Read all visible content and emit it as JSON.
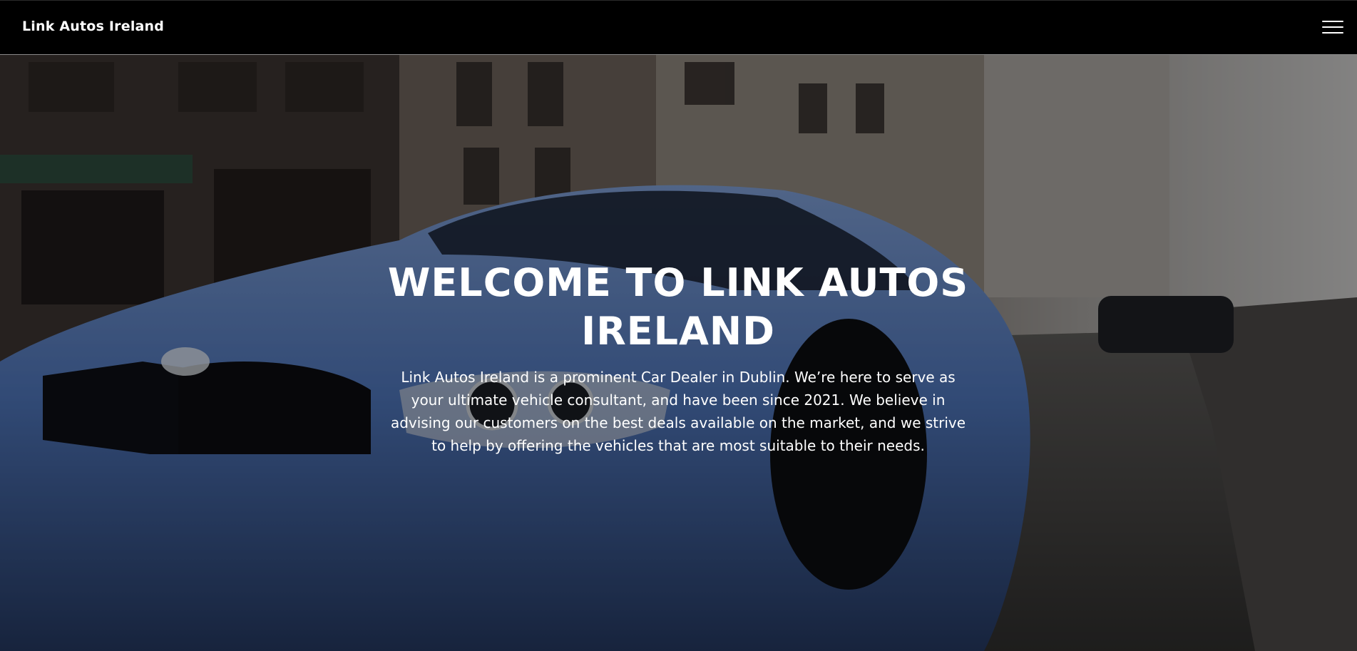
{
  "navbar": {
    "brand": "Link Autos Ireland",
    "menu_icon": "hamburger-menu-icon"
  },
  "hero": {
    "background_image": "blue-sports-car-on-city-street",
    "title": "WELCOME TO LINK AUTOS IRELAND",
    "description": "Link Autos Ireland is a prominent Car Dealer in Dublin. We’re here to serve as your ultimate vehicle consultant, and have been since 2021. We believe in advising our customers on the best deals available on the market, and we strive to help by offering the vehicles that are most suitable to their needs."
  },
  "colors": {
    "navbar_bg": "#000000",
    "text": "#ffffff",
    "car_accent": "#4a6fb0"
  }
}
